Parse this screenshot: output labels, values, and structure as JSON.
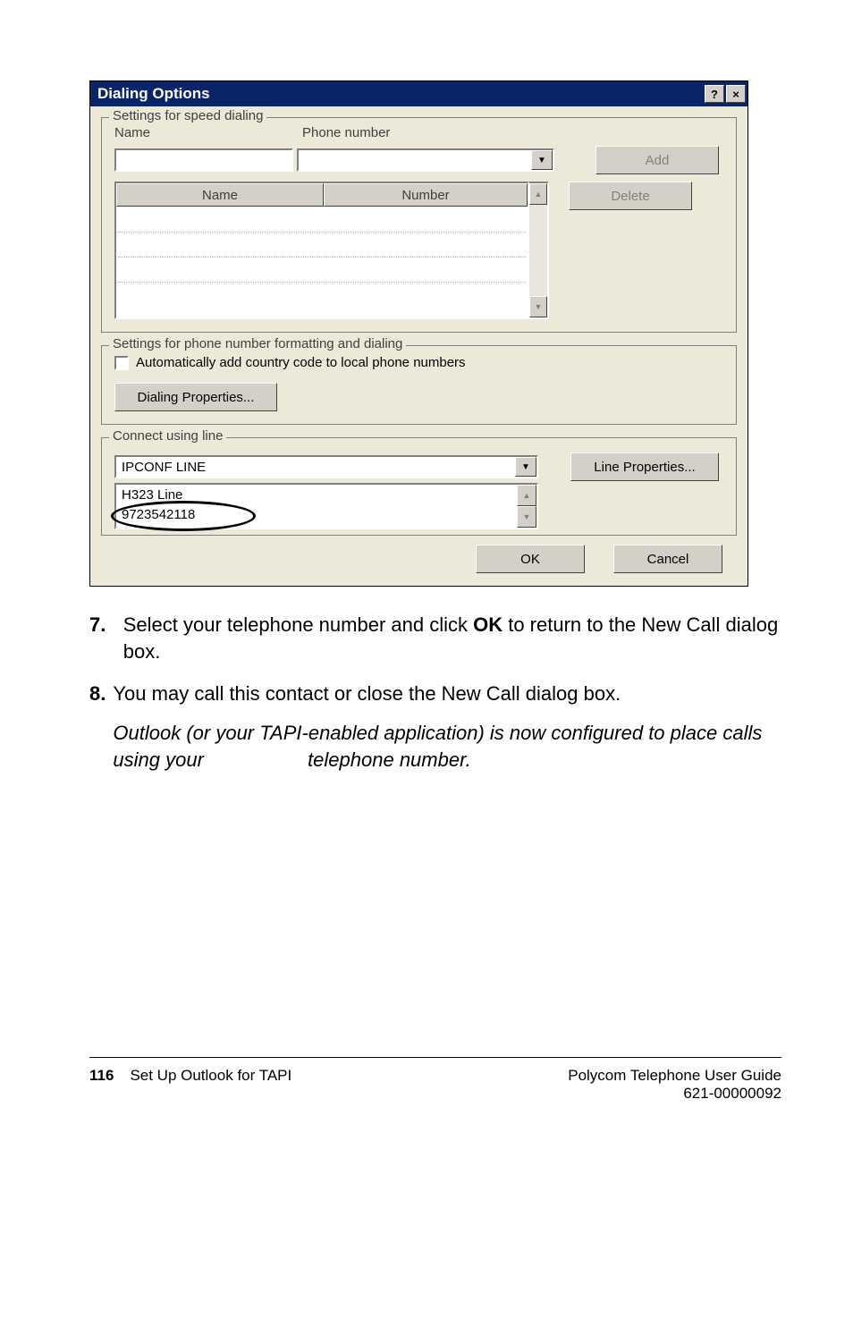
{
  "dialog": {
    "title": "Dialing Options",
    "help_icon": "?",
    "close_icon": "×",
    "group_speed": {
      "legend": "Settings for speed dialing",
      "name_label": "Name",
      "phone_label": "Phone number",
      "name_value": "",
      "phone_value": "",
      "add_btn": "Add",
      "delete_btn": "Delete",
      "col_name": "Name",
      "col_number": "Number"
    },
    "group_format": {
      "legend": "Settings for phone number formatting and dialing",
      "checkbox_label": "Automatically add country code to local phone numbers",
      "dialing_props_btn": "Dialing Properties..."
    },
    "group_connect": {
      "legend": "Connect using line",
      "selected_line": "IPCONF LINE",
      "line_props_btn": "Line Properties...",
      "list_items": [
        "H323 Line",
        "9723542118"
      ]
    },
    "ok_btn": "OK",
    "cancel_btn": "Cancel"
  },
  "instructions": {
    "step7_num": "7.",
    "step7_a": "Select your telephone number and click ",
    "step7_b": "OK",
    "step7_c": " to return to the New Call dialog box.",
    "step8_num": "8.",
    "step8_text": "You may call this contact or close the New Call dialog box.",
    "step8_note_a": "Outlook (or your TAPI-enabled application) is now configured to place calls using your ",
    "step8_note_b": " telephone number."
  },
  "footer": {
    "page_num": "116",
    "left_text": "Set Up Outlook for TAPI",
    "right_line1": "Polycom Telephone User Guide",
    "right_line2": "621-00000092"
  }
}
